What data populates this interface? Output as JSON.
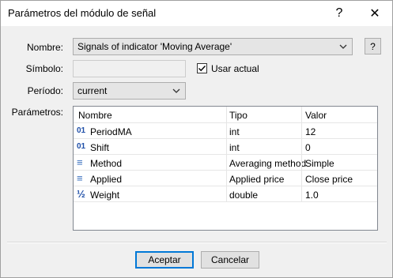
{
  "window": {
    "title": "Parámetros del módulo de señal",
    "help_label": "?",
    "close_label": "✕"
  },
  "form": {
    "name_label": "Nombre:",
    "name_value": "Signals of indicator 'Moving Average'",
    "name_help": "?",
    "symbol_label": "Símbolo:",
    "symbol_value": "",
    "use_current_label": "Usar actual",
    "use_current_checked": true,
    "period_label": "Período:",
    "period_value": "current",
    "params_label": "Parámetros:"
  },
  "params_table": {
    "columns": [
      "Nombre",
      "Tipo",
      "Valor"
    ],
    "rows": [
      {
        "icon": "int-icon",
        "glyph": "01",
        "name": "PeriodMA",
        "type": "int",
        "value": "12"
      },
      {
        "icon": "int-icon",
        "glyph": "01",
        "name": "Shift",
        "type": "int",
        "value": "0"
      },
      {
        "icon": "enum-icon",
        "glyph": "≡",
        "name": "Method",
        "type": "Averaging method",
        "value": "Simple"
      },
      {
        "icon": "enum-icon",
        "glyph": "≡",
        "name": "Applied",
        "type": "Applied price",
        "value": "Close price"
      },
      {
        "icon": "double-icon",
        "glyph": "½",
        "name": "Weight",
        "type": "double",
        "value": "1.0"
      }
    ]
  },
  "buttons": {
    "ok": "Aceptar",
    "cancel": "Cancelar"
  }
}
